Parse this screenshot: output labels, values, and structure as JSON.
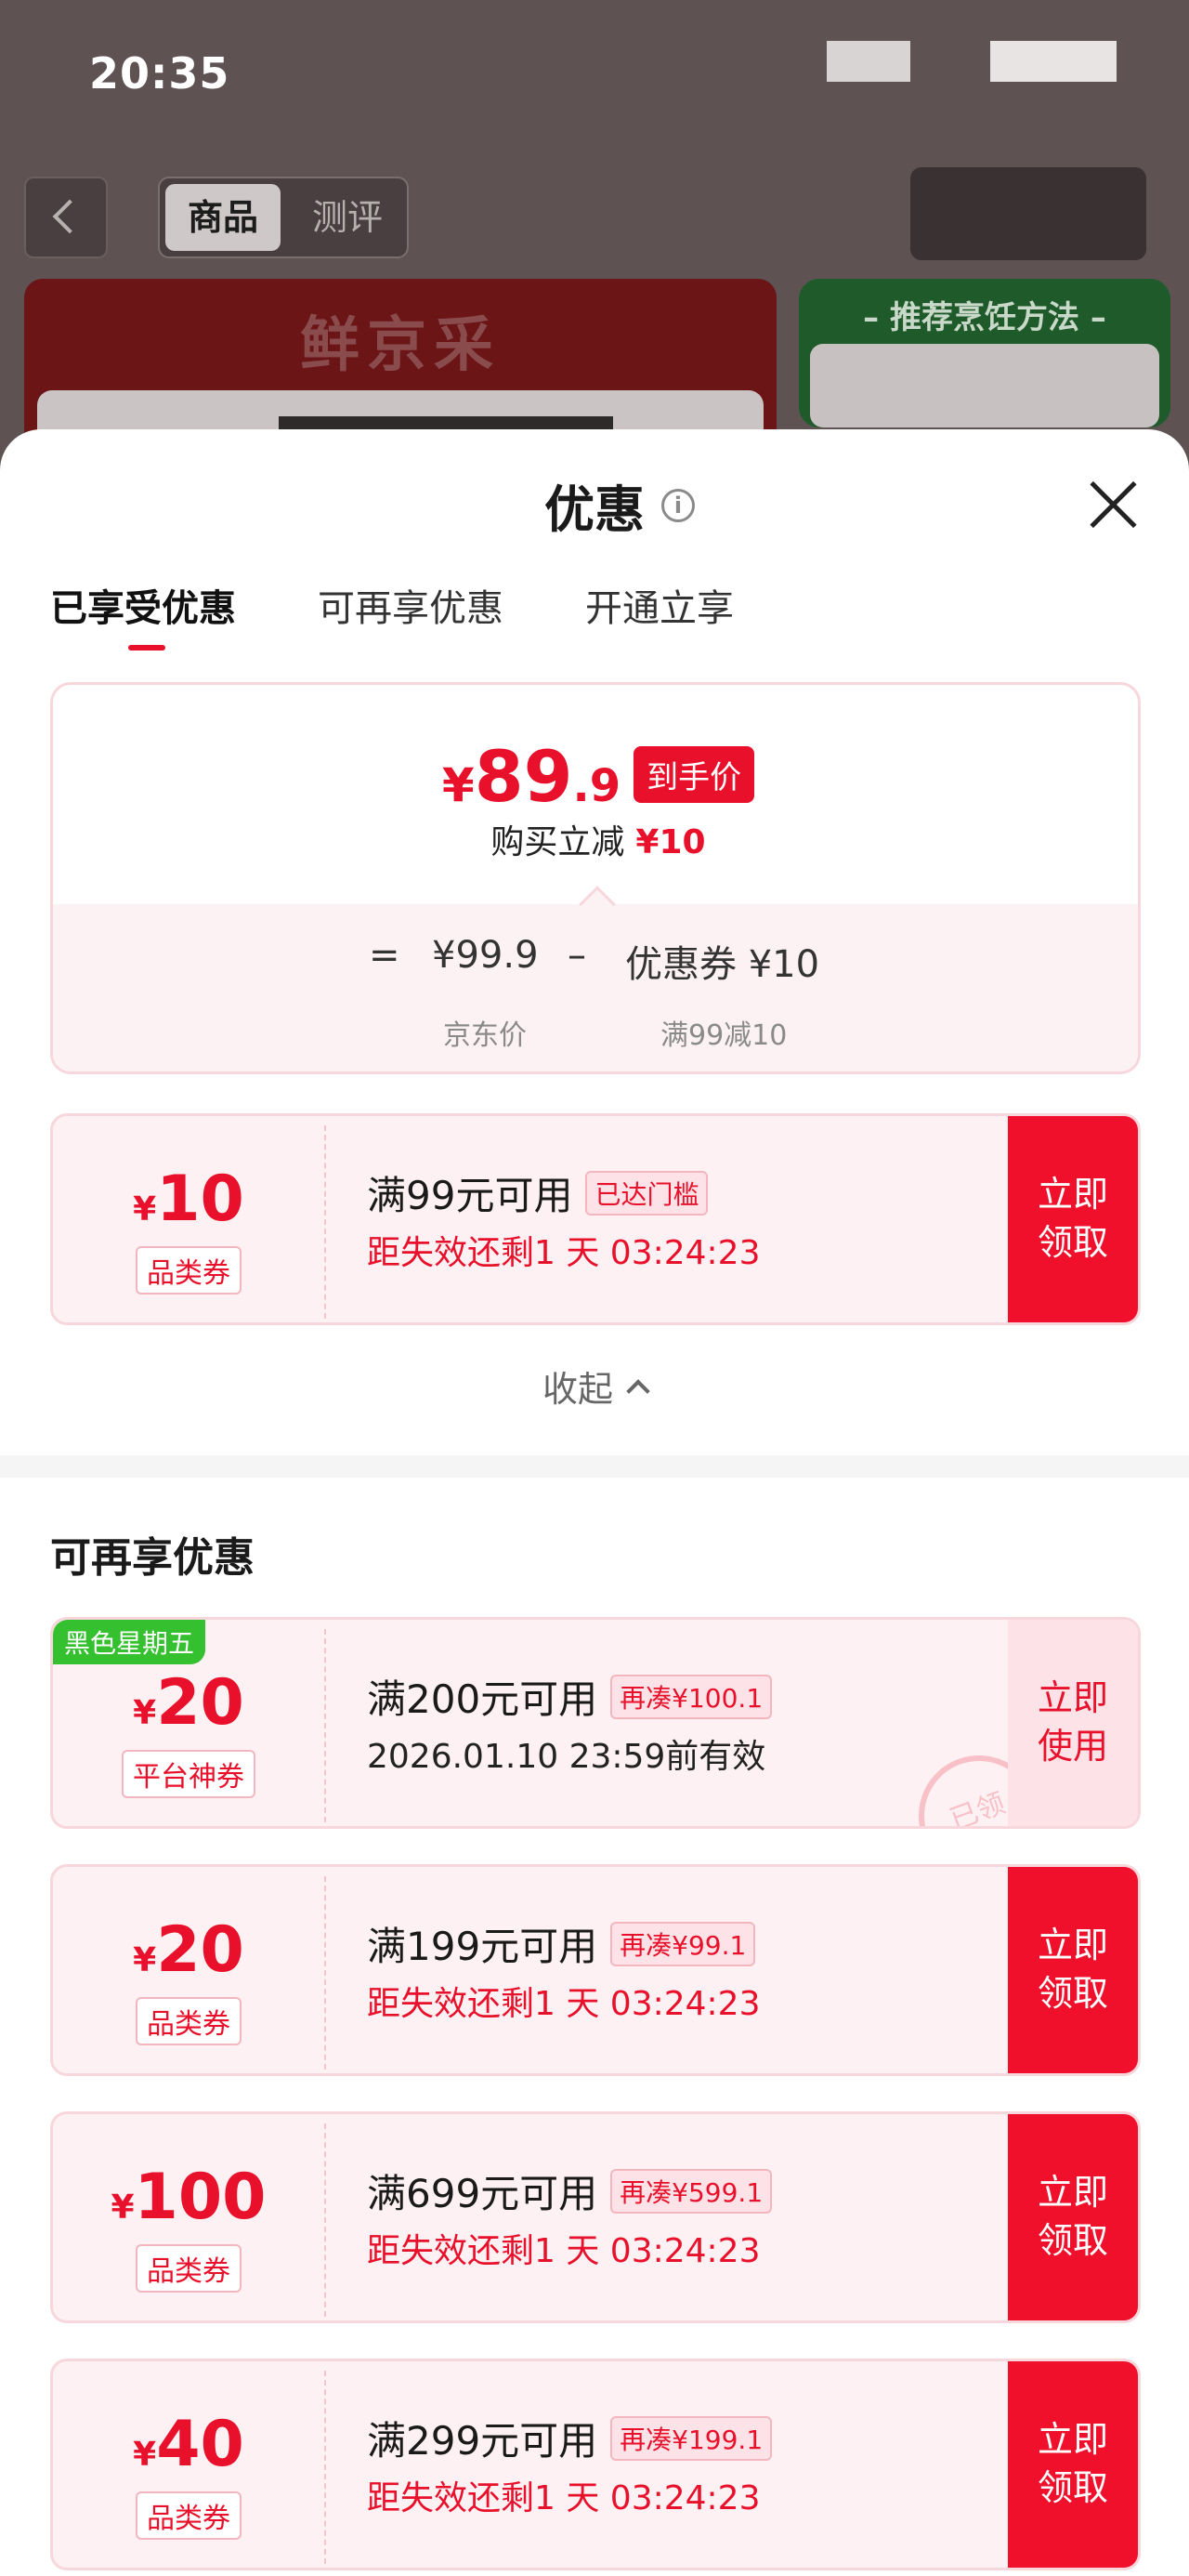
{
  "status_bar": {
    "time": "20:35"
  },
  "background_page": {
    "segment_tabs": [
      "商品",
      "测评"
    ],
    "banner_left_brand": "鲜京采",
    "banner_right_title": "– 推荐烹饪方法 –"
  },
  "sheet": {
    "title": "优惠",
    "info_icon": "i",
    "tabs": [
      "已享受优惠",
      "可再享优惠",
      "开通立享"
    ],
    "accent_color": "#e8102a"
  },
  "summary": {
    "yen": "¥",
    "price_int": "89",
    "price_dec": ".9",
    "price_tag": "到手价",
    "saved_label": "购买立减",
    "saved_amount": "¥10",
    "calc": {
      "equals": "=",
      "original": "¥99.9",
      "minus": "–",
      "discount": "优惠券 ¥10",
      "original_label": "京东价",
      "discount_label": "满99减10"
    }
  },
  "enjoyed_coupons": [
    {
      "yen": "¥",
      "amount": "10",
      "type": "品类券",
      "condition": "满99元可用",
      "badge": "已达门槛",
      "expiry": "距失效还剩1 天 03:24:23",
      "button": "立即\n领取"
    }
  ],
  "collapse_label": "收起",
  "more_section_title": "可再享优惠",
  "more_coupons": [
    {
      "tag": "黑色星期五",
      "yen": "¥",
      "amount": "20",
      "type": "平台神券",
      "condition": "满200元可用",
      "badge": "再凑¥100.1",
      "expiry": "2026.01.10 23:59前有效",
      "button": "立即\n使用",
      "stamp": "已领"
    },
    {
      "yen": "¥",
      "amount": "20",
      "type": "品类券",
      "condition": "满199元可用",
      "badge": "再凑¥99.1",
      "expiry": "距失效还剩1 天 03:24:23",
      "button": "立即\n领取"
    },
    {
      "yen": "¥",
      "amount": "100",
      "type": "品类券",
      "condition": "满699元可用",
      "badge": "再凑¥599.1",
      "expiry": "距失效还剩1 天 03:24:23",
      "button": "立即\n领取"
    },
    {
      "yen": "¥",
      "amount": "40",
      "type": "品类券",
      "condition": "满299元可用",
      "badge": "再凑¥199.1",
      "expiry": "距失效还剩1 天 03:24:23",
      "button": "立即\n领取"
    }
  ]
}
